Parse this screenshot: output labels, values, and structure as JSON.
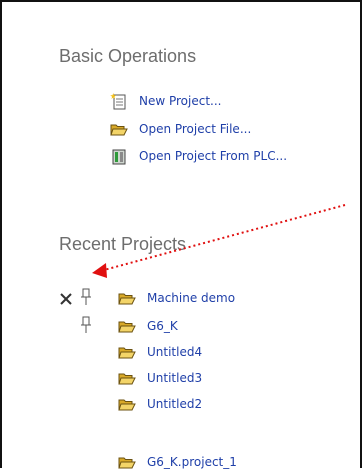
{
  "basic_operations": {
    "title": "Basic Operations",
    "items": [
      {
        "label": "New Project...",
        "icon": "new-document-icon"
      },
      {
        "label": "Open Project File...",
        "icon": "open-folder-icon"
      },
      {
        "label": "Open Project From PLC...",
        "icon": "plc-device-icon"
      }
    ]
  },
  "recent_projects": {
    "title": "Recent Projects",
    "items": [
      {
        "label": "Machine demo",
        "icon": "open-folder-icon",
        "remove_icon": "close-x-icon",
        "pin_icon": "pin-icon"
      },
      {
        "label": "G6_K",
        "icon": "open-folder-icon",
        "pin_icon": "pin-icon"
      },
      {
        "label": "Untitled4",
        "icon": "open-folder-icon"
      },
      {
        "label": "Untitled3",
        "icon": "open-folder-icon"
      },
      {
        "label": "Untitled2",
        "icon": "open-folder-icon"
      },
      {
        "label": "G6_K.project_1",
        "icon": "open-folder-icon"
      }
    ]
  },
  "annotation": {
    "color": "#e01010",
    "style": "dotted-arrow"
  },
  "colors": {
    "link": "#1f3fa8",
    "section_title": "#6d6d6d",
    "folder": "#e8c34a"
  }
}
